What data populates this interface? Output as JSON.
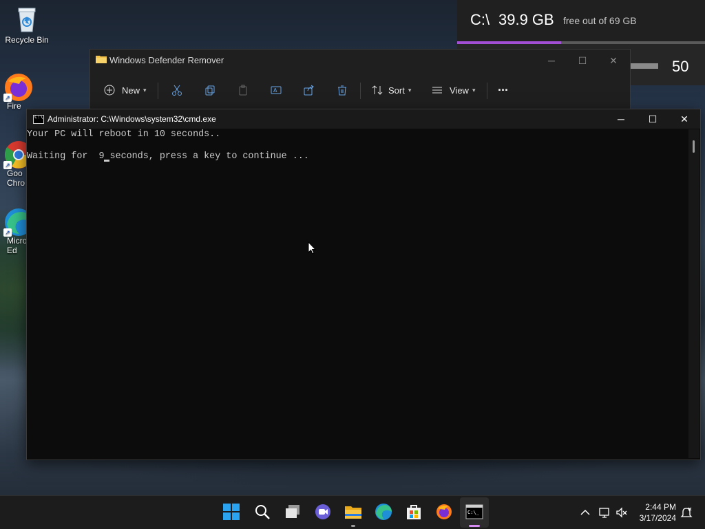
{
  "desktop": {
    "icons": [
      {
        "label": "Recycle Bin"
      },
      {
        "label": "Fire"
      },
      {
        "label": "Goo\nChro"
      },
      {
        "label": "Micro\nEd"
      }
    ]
  },
  "disk_widget": {
    "drive": "C:\\",
    "free_size": "39.9 GB",
    "free_text": "free out of 69 GB",
    "used_fraction": 0.42,
    "bar_color": "#a24fd6",
    "second_value": "50"
  },
  "explorer": {
    "title": "Windows Defender Remover",
    "toolbar": {
      "new_label": "New",
      "sort_label": "Sort",
      "view_label": "View",
      "more_label": "···"
    }
  },
  "cmd": {
    "title": "Administrator: C:\\Windows\\system32\\cmd.exe",
    "lines": [
      "Your PC will reboot in 10 seconds..",
      "",
      "Waiting for  9 seconds, press a key to continue ..."
    ]
  },
  "taskbar": {
    "apps": [
      "start-icon",
      "search-icon",
      "task-view-icon",
      "chat-icon",
      "file-explorer-icon",
      "edge-icon",
      "store-icon",
      "firefox-icon",
      "cmd-icon"
    ],
    "time": "2:44 PM",
    "date": "3/17/2024"
  }
}
